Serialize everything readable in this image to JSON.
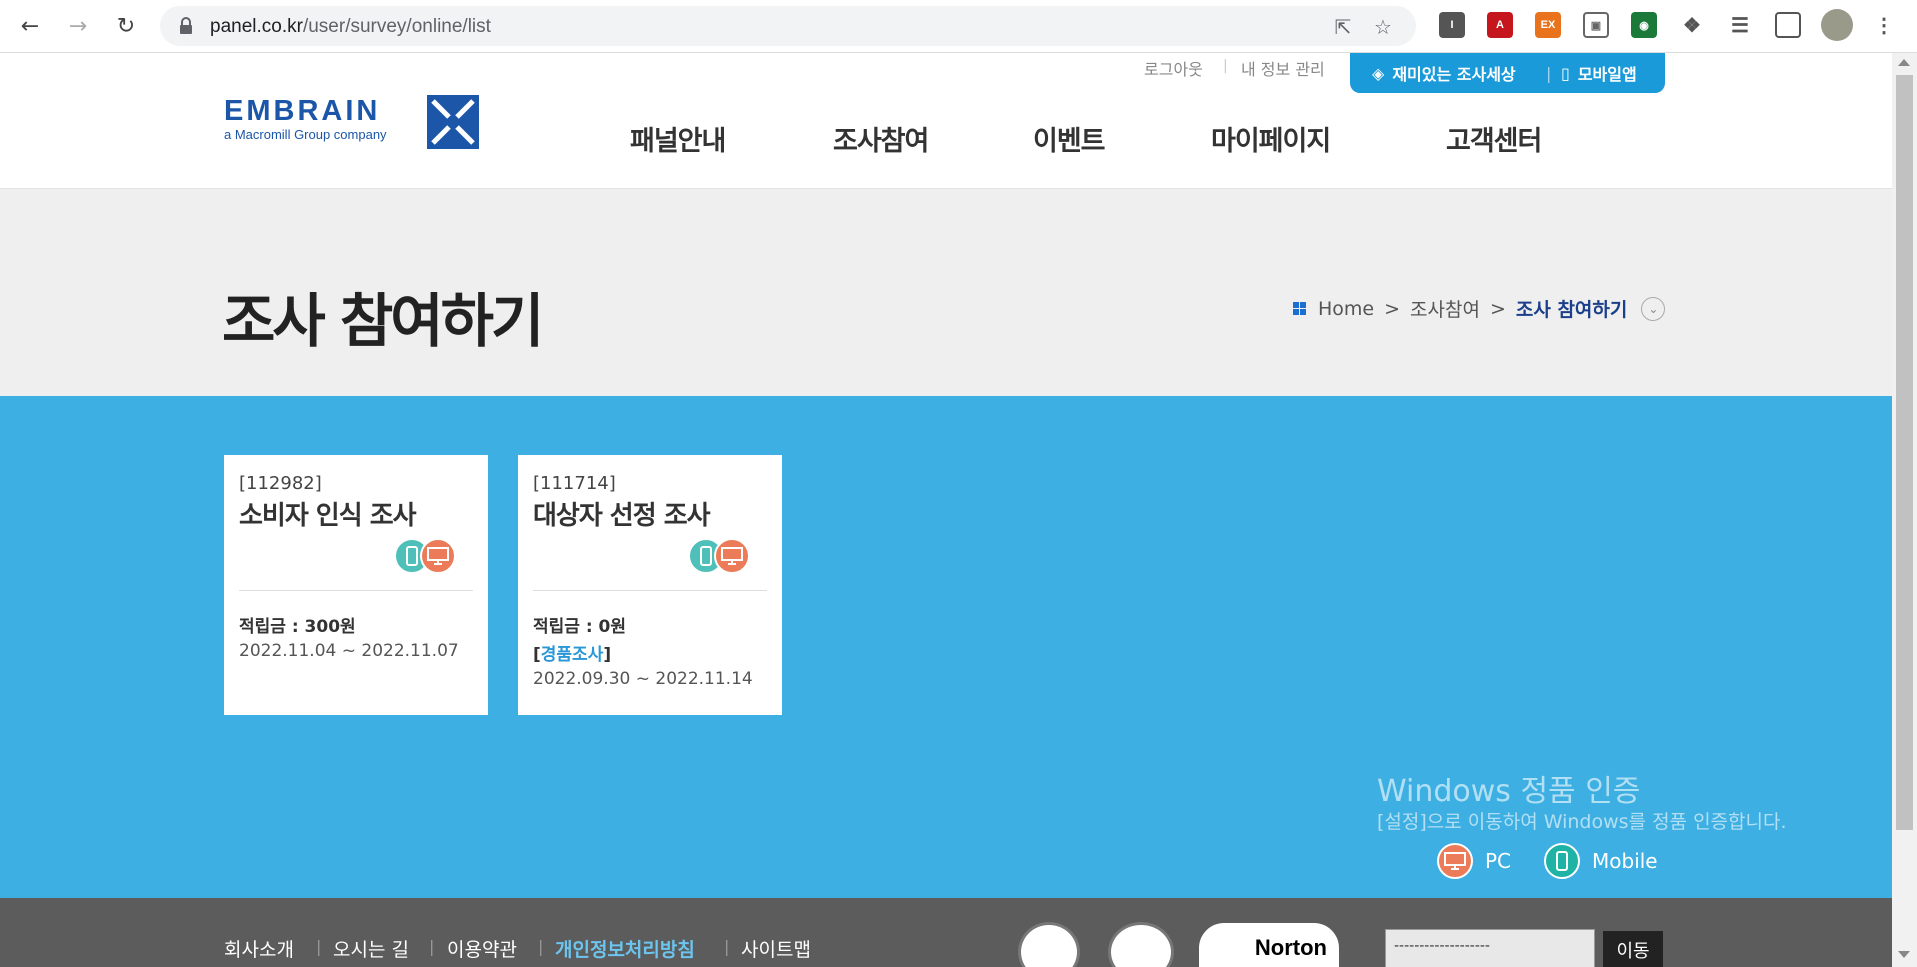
{
  "browser": {
    "url_host": "panel.co.kr",
    "url_path": "/user/survey/online/list"
  },
  "header": {
    "logo_text": "EMBRAIN",
    "logo_sub": "a Macromill Group company",
    "util_links": [
      "로그아웃",
      "내 정보 관리"
    ],
    "app_links": [
      "재미있는 조사세상",
      "모바일앱"
    ],
    "gnb": [
      "패널안내",
      "조사참여",
      "이벤트",
      "마이페이지",
      "고객센터"
    ]
  },
  "title_band": {
    "title": "조사 참여하기",
    "breadcrumb": [
      "Home",
      "조사참여",
      "조사 참여하기"
    ],
    "sep": ">"
  },
  "surveys": [
    {
      "id": "[112982]",
      "title": "소비자 인식 조사",
      "reward": "적립금 : 300원",
      "type_prefix": "",
      "type_label": "",
      "type_suffix": "",
      "period": "2022.11.04 ~ 2022.11.07"
    },
    {
      "id": "[111714]",
      "title": "대상자 선정 조사",
      "reward": "적립금 : 0원",
      "type_prefix": "[",
      "type_label": "경품조사",
      "type_suffix": "]",
      "period": "2022.09.30 ~ 2022.11.14"
    }
  ],
  "legend": {
    "pc": "PC",
    "mobile": "Mobile"
  },
  "watermark": {
    "title": "Windows 정품 인증",
    "sub": "[설정]으로 이동하여 Windows를 정품 인증합니다."
  },
  "footer": {
    "links": [
      "회사소개",
      "오시는 길",
      "이용약관",
      "개인정보처리방침",
      "사이트맵"
    ],
    "norton": "Norton",
    "family_select": "-------------------",
    "go_label": "이동"
  },
  "colors": {
    "brand_blue": "#1b56a8",
    "content_bg": "#3eafe2",
    "pc": "#ec7c59",
    "mobile": "#4fc0b9"
  }
}
